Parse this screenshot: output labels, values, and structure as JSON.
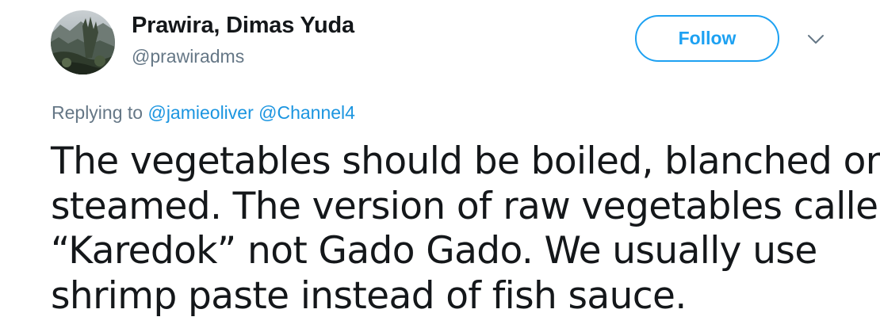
{
  "author": {
    "display_name": "Prawira, Dimas Yuda",
    "handle": "@prawiradms"
  },
  "actions": {
    "follow_label": "Follow",
    "more_icon": "chevron-down-icon"
  },
  "reply": {
    "prefix": "Replying to",
    "mentions": [
      "@jamieoliver",
      "@Channel4"
    ]
  },
  "tweet": {
    "lines": [
      "The vegetables should be boiled, blanched or",
      "steamed. The version of raw vegetables called",
      "“Karedok” not Gado Gado. We usually use",
      "shrimp paste instead of fish sauce."
    ]
  },
  "colors": {
    "accent": "#1da1f2",
    "mention": "#1b95e0",
    "secondary_text": "#657786",
    "primary_text": "#14171a"
  }
}
